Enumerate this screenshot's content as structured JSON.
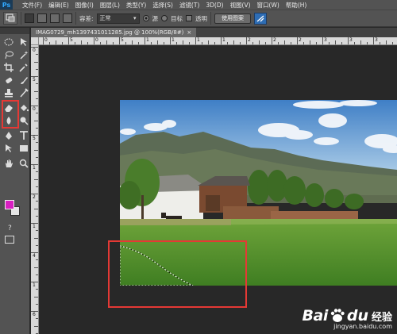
{
  "menu": {
    "logo": "Ps",
    "items": [
      "文件(F)",
      "编辑(E)",
      "图像(I)",
      "图层(L)",
      "类型(Y)",
      "选择(S)",
      "滤镜(T)",
      "3D(D)",
      "视图(V)",
      "窗口(W)",
      "帮助(H)"
    ]
  },
  "options": {
    "tolerance_label": "容差:",
    "mode_value": "正常",
    "radio_source_label": "源",
    "radio_target_label": "目标",
    "transparent_label": "透明",
    "use_pattern_label": "使用图案"
  },
  "document": {
    "tab_title": "IMAG0729_mh1397431011285.jpg @ 100%(RGB/8#)",
    "close_glyph": "×"
  },
  "ruler_top": [
    "0",
    "5",
    "0",
    "5",
    "1",
    "1",
    "1",
    "1",
    "2",
    "2",
    "2",
    "3",
    "3",
    "3"
  ],
  "ruler_left": [
    "0",
    "5",
    "0",
    "5",
    "1",
    "2",
    "1",
    "4",
    "1",
    "6"
  ],
  "toolbar": {
    "help_glyph": "?",
    "foreground_color": "#d81fc1",
    "background_color": "#e6e6e6"
  },
  "watermark": {
    "brand_bai": "Bai",
    "brand_du": "du",
    "brand_cn": "经验",
    "url": "jingyan.baidu.com"
  },
  "colors": {
    "highlight": "#e53935",
    "menubar": "#535353",
    "workspace": "#282828"
  }
}
